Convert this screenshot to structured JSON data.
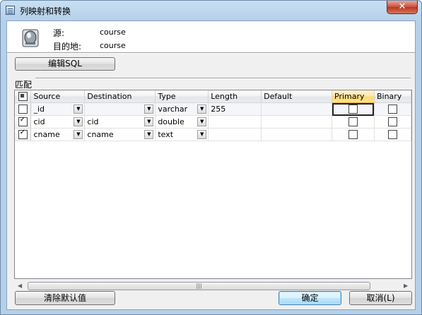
{
  "window": {
    "title": "列映射和转换",
    "close_glyph": "✕"
  },
  "header": {
    "source_label": "源:",
    "source_value": "course",
    "dest_label": "目的地:",
    "dest_value": "course"
  },
  "edit_sql_button": "编辑SQL",
  "mapping_label": "匹配",
  "grid": {
    "columns": [
      "Source",
      "Destination",
      "Type",
      "Length",
      "Default",
      "Primary",
      "Binary"
    ],
    "rows": [
      {
        "checked": false,
        "source": "_id",
        "destination": "",
        "type": "varchar",
        "length": "255",
        "default": "",
        "primary": false,
        "binary": false
      },
      {
        "checked": true,
        "source": "cid",
        "destination": "cid",
        "type": "double",
        "length": "",
        "default": "",
        "primary": false,
        "binary": false
      },
      {
        "checked": true,
        "source": "cname",
        "destination": "cname",
        "type": "text",
        "length": "",
        "default": "",
        "primary": false,
        "binary": false
      }
    ]
  },
  "scrollbar": {
    "left_arrow": "◀",
    "right_arrow": "▶",
    "grip": "|||"
  },
  "footer": {
    "clear_defaults": "清除默认值",
    "ok": "确定",
    "cancel": "取消(L)"
  }
}
